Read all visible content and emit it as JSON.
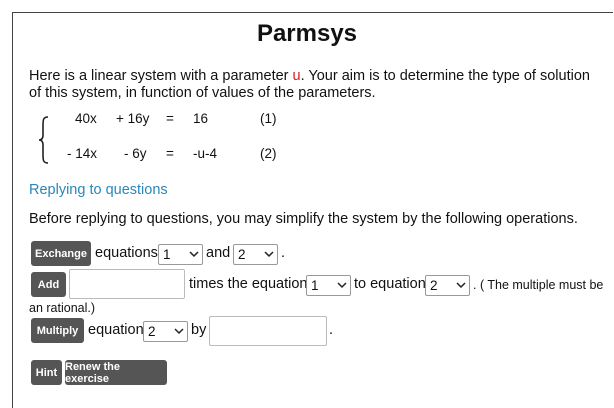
{
  "title": "Parmsys",
  "intro": {
    "before": "Here is a linear system with a parameter ",
    "param": "u",
    "after": ". Your aim is to determine the type of solution of this system, in function of values of the parameters."
  },
  "system": {
    "rows": [
      {
        "a": "40x",
        "b": "+ 16y",
        "eq": "=",
        "rhs": "16",
        "num": "(1)"
      },
      {
        "a": "- 14x",
        "b": "- 6y",
        "eq": "=",
        "rhs": "-u-4",
        "num": "(2)"
      }
    ]
  },
  "link": "Replying to questions",
  "paragraph": "Before replying to questions, you may simplify the system by the following operations.",
  "exchange": {
    "button": "Exchange",
    "text1": "equations",
    "select1": "1",
    "text2": "and",
    "select2": "2",
    "end": "."
  },
  "add": {
    "button": "Add",
    "input": "",
    "text1": "times the equation",
    "select1": "1",
    "text2": "to equation",
    "select2": "2",
    "note1": ". ( The multiple must be",
    "note2": "an rational.)"
  },
  "multiply": {
    "button": "Multiply",
    "text1": "equation",
    "select1": "2",
    "text2": "by",
    "input": "",
    "end": "."
  },
  "hint": "Hint",
  "renew": "Renew the exercise"
}
